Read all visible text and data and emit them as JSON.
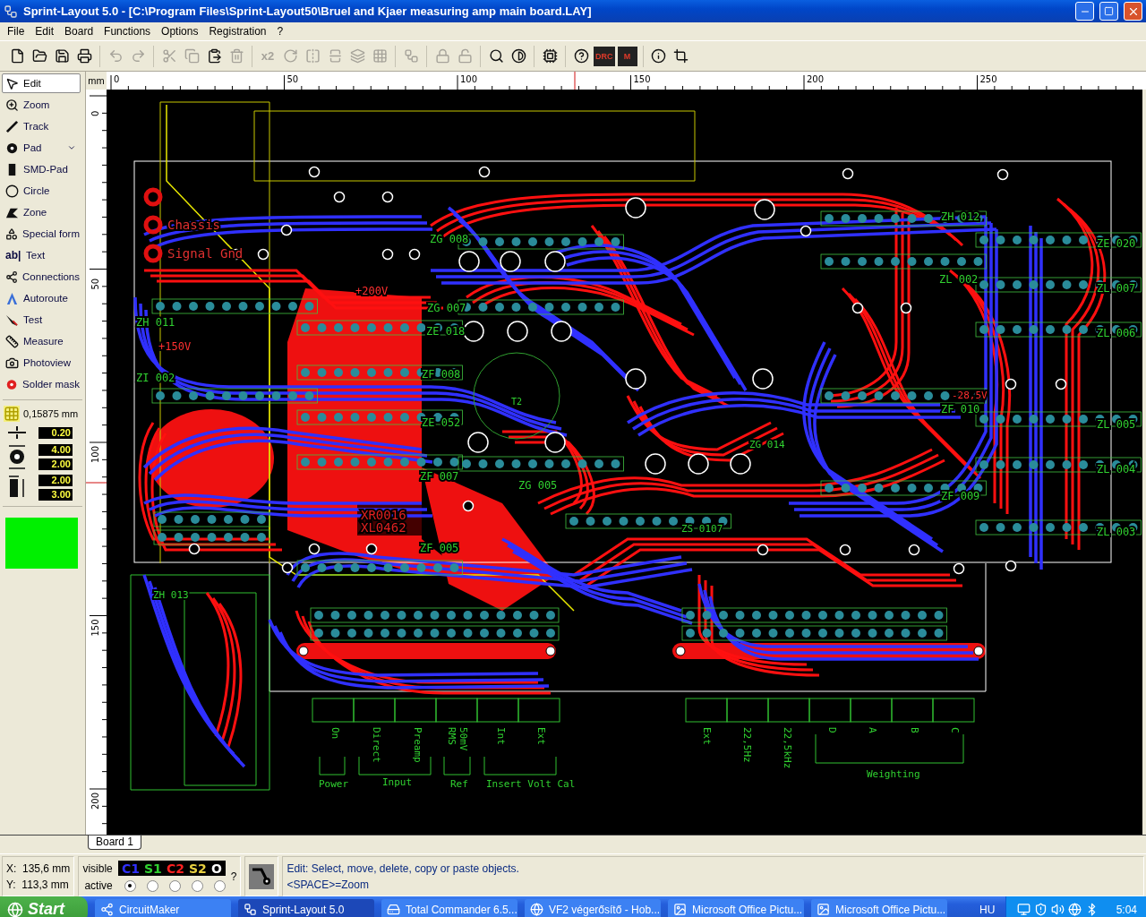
{
  "window": {
    "title": "Sprint-Layout 5.0 - [C:\\Program Files\\Sprint-Layout50\\Bruel and Kjaer measuring amp main board.LAY]"
  },
  "menu": [
    "File",
    "Edit",
    "Board",
    "Functions",
    "Options",
    "Registration",
    "?"
  ],
  "toolbar": [
    [
      {
        "kind": "icon",
        "disabled": false
      },
      {
        "kind": "icon",
        "disabled": false
      },
      {
        "kind": "icon",
        "disabled": false
      },
      {
        "kind": "icon",
        "disabled": false
      }
    ],
    [
      {
        "kind": "icon",
        "disabled": true
      },
      {
        "kind": "icon",
        "disabled": true
      }
    ],
    [
      {
        "kind": "icon",
        "disabled": true
      },
      {
        "kind": "icon",
        "disabled": true
      },
      {
        "kind": "icon",
        "disabled": false
      },
      {
        "kind": "icon",
        "disabled": true
      }
    ],
    [
      {
        "kind": "text",
        "label": "x2",
        "disabled": true
      },
      {
        "kind": "icon",
        "disabled": true
      },
      {
        "kind": "icon",
        "disabled": true
      },
      {
        "kind": "icon",
        "disabled": true
      },
      {
        "kind": "icon",
        "disabled": true
      },
      {
        "kind": "icon",
        "disabled": true
      }
    ],
    [
      {
        "kind": "icon",
        "disabled": true
      }
    ],
    [
      {
        "kind": "icon",
        "disabled": true
      },
      {
        "kind": "icon",
        "disabled": true
      }
    ],
    [
      {
        "kind": "icon",
        "disabled": false
      },
      {
        "kind": "icon",
        "disabled": false
      }
    ],
    [
      {
        "kind": "icon",
        "disabled": false
      }
    ],
    [
      {
        "kind": "icon",
        "disabled": false
      },
      {
        "kind": "text",
        "label": "DRC",
        "disabled": false
      },
      {
        "kind": "text",
        "label": "M",
        "disabled": false
      }
    ],
    [
      {
        "kind": "icon",
        "disabled": false
      },
      {
        "kind": "icon",
        "disabled": false
      }
    ]
  ],
  "tools": [
    {
      "label": "Edit",
      "selected": true,
      "dropdown": false
    },
    {
      "label": "Zoom",
      "selected": false,
      "dropdown": false
    },
    {
      "label": "Track",
      "selected": false,
      "dropdown": false
    },
    {
      "label": "Pad",
      "selected": false,
      "dropdown": true
    },
    {
      "label": "SMD-Pad",
      "selected": false,
      "dropdown": false
    },
    {
      "label": "Circle",
      "selected": false,
      "dropdown": false
    },
    {
      "label": "Zone",
      "selected": false,
      "dropdown": false
    },
    {
      "label": "Special form",
      "selected": false,
      "dropdown": false
    },
    {
      "label": "Text",
      "selected": false,
      "dropdown": false,
      "glyph": "ab|"
    },
    {
      "label": "Connections",
      "selected": false,
      "dropdown": false
    },
    {
      "label": "Autoroute",
      "selected": false,
      "dropdown": false
    },
    {
      "label": "Test",
      "selected": false,
      "dropdown": false
    },
    {
      "label": "Measure",
      "selected": false,
      "dropdown": false
    },
    {
      "label": "Photoview",
      "selected": false,
      "dropdown": false
    },
    {
      "label": "Solder mask",
      "selected": false,
      "dropdown": false
    }
  ],
  "grid": "0,15875 mm",
  "settings": [
    [
      "0.20"
    ],
    [
      "4.00",
      "2.00"
    ],
    [
      "2.00",
      "3.00"
    ]
  ],
  "ruler": {
    "unit": "mm",
    "x_labels": [
      "0",
      "50",
      "100",
      "150",
      "200",
      "250"
    ],
    "y_labels": [
      "0",
      "50",
      "100",
      "150",
      "200"
    ]
  },
  "board_labels": [
    "Chassis",
    "Signal Gnd",
    "ZH 011",
    "ZI 002",
    "ZG 008",
    "ZG 007",
    "ZE 018",
    "ZF 008",
    "ZE 052",
    "ZF 007",
    "ZG 005",
    "ZF 005",
    "ZH 012",
    "ZL 002",
    "ZE 020",
    "ZL 007",
    "ZL 006",
    "ZF 010",
    "ZL 005",
    "ZL 004",
    "ZF 009",
    "ZL 003",
    "ZG 014",
    "ZS 0107",
    "ZH 013",
    "+200V",
    "+150V",
    "-28,5V",
    "XR0016",
    "XL0462",
    "T2"
  ],
  "connector_labels": [
    "On",
    "Direct",
    "Preamp",
    "RMS",
    "50mV",
    "Int",
    "Ext",
    "Ext",
    "22,5Hz",
    "22,5kHz",
    "D",
    "A",
    "B",
    "C"
  ],
  "group_labels": [
    "Power",
    "Input",
    "Ref",
    "Insert Volt Cal",
    "Weighting"
  ],
  "tabs": [
    {
      "label": "Board 1",
      "selected": true
    }
  ],
  "status": {
    "x": "X:  135,6 mm",
    "y": "Y:  113,3 mm",
    "visible_label": "visible",
    "active_label": "active",
    "help_mark": "?",
    "layers": [
      {
        "label": "C1",
        "selected": true
      },
      {
        "label": "S1",
        "selected": false
      },
      {
        "label": "C2",
        "selected": false
      },
      {
        "label": "S2",
        "selected": false
      },
      {
        "label": "O",
        "selected": false
      }
    ],
    "hint": [
      "Edit: Select, move, delete, copy or paste objects.",
      "<SPACE>=Zoom"
    ]
  },
  "taskbar": {
    "start": "Start",
    "items": [
      {
        "label": "CircuitMaker",
        "selected": false
      },
      {
        "label": "Sprint-Layout 5.0",
        "selected": true
      },
      {
        "label": "Total Commander 6.5...",
        "selected": false
      },
      {
        "label": "VF2 végerősítő - Hob...",
        "selected": false
      },
      {
        "label": "Microsoft Office Pictu...",
        "selected": false
      },
      {
        "label": "Microsoft Office Pictu...",
        "selected": false
      }
    ],
    "language": "HU",
    "clock": "5:04"
  }
}
